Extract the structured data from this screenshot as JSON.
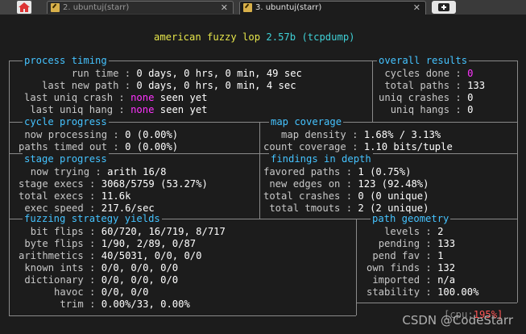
{
  "tabs": [
    {
      "label": "2. ubuntuj(starr)",
      "active": false
    },
    {
      "label": "3. ubuntuj(starr)",
      "active": true
    }
  ],
  "title": {
    "name": "american fuzzy lop",
    "version": "2.57b",
    "target": "(tcpdump)"
  },
  "process_timing": {
    "header": "process timing",
    "run_time_label": "run time",
    "run_time": "0 days, 0 hrs, 0 min, 49 sec",
    "last_new_path_label": "last new path",
    "last_new_path": "0 days, 0 hrs, 0 min, 4 sec",
    "last_uniq_crash_label": "last uniq crash",
    "last_uniq_crash_a": "none",
    "last_uniq_crash_b": "seen yet",
    "last_uniq_hang_label": "last uniq hang",
    "last_uniq_hang_a": "none",
    "last_uniq_hang_b": "seen yet"
  },
  "overall_results": {
    "header": "overall results",
    "cycles_done_label": "cycles done",
    "cycles_done": "0",
    "total_paths_label": "total paths",
    "total_paths": "133",
    "uniq_crashes_label": "uniq crashes",
    "uniq_crashes": "0",
    "uniq_hangs_label": "uniq hangs",
    "uniq_hangs": "0"
  },
  "cycle_progress": {
    "header": "cycle progress",
    "now_processing_label": "now processing",
    "now_processing": "0 (0.00%)",
    "paths_timed_out_label": "paths timed out",
    "paths_timed_out": "0 (0.00%)"
  },
  "map_coverage": {
    "header": "map coverage",
    "map_density_label": "map density",
    "map_density": "1.68% / 3.13%",
    "count_coverage_label": "count coverage",
    "count_coverage": "1.10 bits/tuple"
  },
  "stage_progress": {
    "header": "stage progress",
    "now_trying_label": "now trying",
    "now_trying": "arith 16/8",
    "stage_execs_label": "stage execs",
    "stage_execs": "3068/5759 (53.27%)",
    "total_execs_label": "total execs",
    "total_execs": "11.6k",
    "exec_speed_label": "exec speed",
    "exec_speed": "217.6/sec"
  },
  "findings": {
    "header": "findings in depth",
    "favored_paths_label": "favored paths",
    "favored_paths": "1 (0.75%)",
    "new_edges_on_label": "new edges on",
    "new_edges_on": "123 (92.48%)",
    "total_crashes_label": "total crashes",
    "total_crashes": "0 (0 unique)",
    "total_tmouts_label": "total tmouts",
    "total_tmouts": "2 (2 unique)"
  },
  "strategy": {
    "header": "fuzzing strategy yields",
    "rows": [
      {
        "label": "bit flips",
        "value": "60/720, 16/719, 8/717"
      },
      {
        "label": "byte flips",
        "value": "1/90, 2/89, 0/87"
      },
      {
        "label": "arithmetics",
        "value": "40/5031, 0/0, 0/0"
      },
      {
        "label": "known ints",
        "value": "0/0, 0/0, 0/0"
      },
      {
        "label": "dictionary",
        "value": "0/0, 0/0, 0/0"
      },
      {
        "label": "havoc",
        "value": "0/0, 0/0"
      },
      {
        "label": "trim",
        "value": "0.00%/33, 0.00%"
      }
    ]
  },
  "path_geometry": {
    "header": "path geometry",
    "rows": [
      {
        "label": "levels",
        "value": "2"
      },
      {
        "label": "pending",
        "value": "133"
      },
      {
        "label": "pend fav",
        "value": "1"
      },
      {
        "label": "own finds",
        "value": "132"
      },
      {
        "label": "imported",
        "value": "n/a"
      },
      {
        "label": "stability",
        "value": "100.00%"
      }
    ]
  },
  "cpu": {
    "label": "[cpu:",
    "value": "195%]"
  },
  "watermark": "CSDN @CodeStarr",
  "colors": {
    "header": "#45c3ff",
    "title": "#e5e54a",
    "highlight": "#ff33ff",
    "cpu": "#ff5555"
  }
}
